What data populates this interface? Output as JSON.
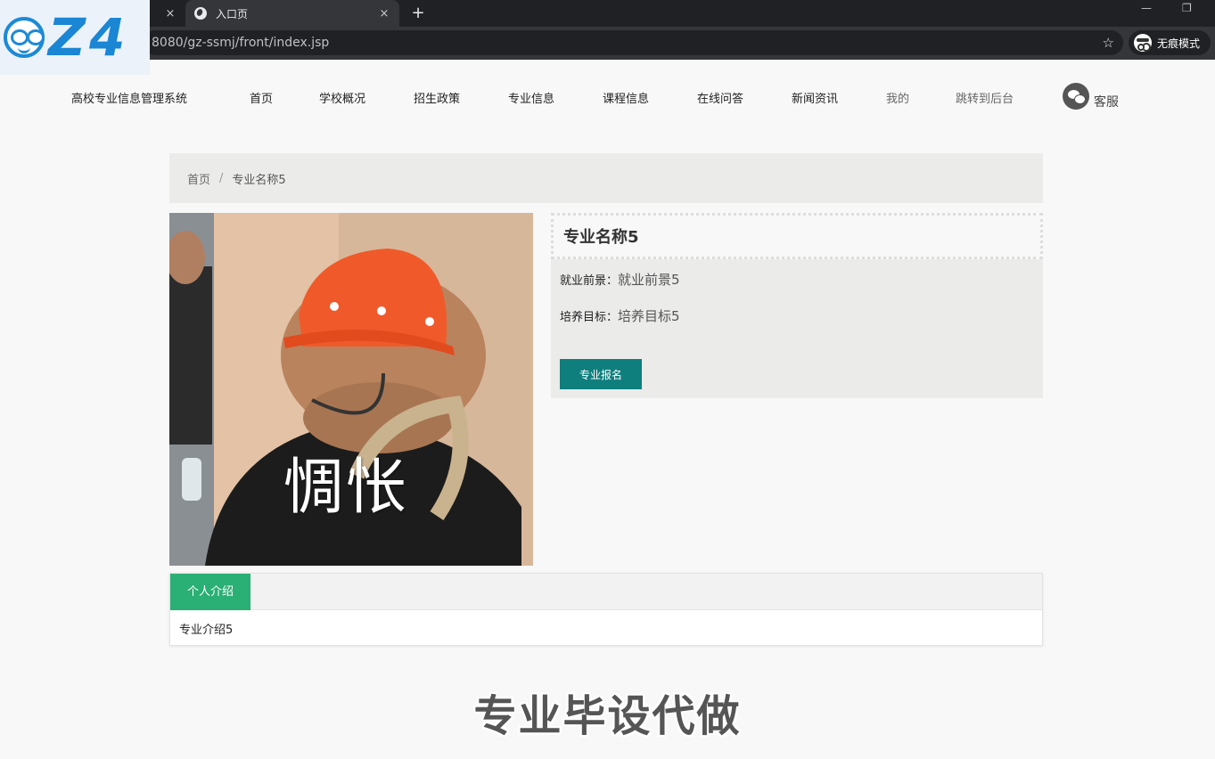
{
  "browser": {
    "tab_active_title": "入口页",
    "url": "8080/gz-ssmj/front/index.jsp",
    "incognito_label": "无痕模式",
    "new_tab_symbol": "+",
    "close_symbol": "×",
    "star_symbol": "☆"
  },
  "logo": {
    "text": "Z4"
  },
  "nav": {
    "brand": "高校专业信息管理系统",
    "items": [
      "首页",
      "学校概况",
      "招生政策",
      "专业信息",
      "课程信息",
      "在线问答",
      "新闻资讯",
      "我的",
      "跳转到后台"
    ],
    "service": "客服"
  },
  "breadcrumb": {
    "home": "首页",
    "separator": "/",
    "current": "专业名称5"
  },
  "photo": {
    "caption": "惆怅"
  },
  "detail": {
    "title": "专业名称5",
    "prospect_label": "就业前景：",
    "prospect_value": "就业前景5",
    "goal_label": "培养目标：",
    "goal_value": "培养目标5",
    "apply_button": "专业报名"
  },
  "intro": {
    "tab_label": "个人介绍",
    "content": "专业介绍5"
  },
  "watermark": "专业毕设代做",
  "colors": {
    "accent_teal": "#0f7f7e",
    "tab_green": "#2aaf74"
  }
}
